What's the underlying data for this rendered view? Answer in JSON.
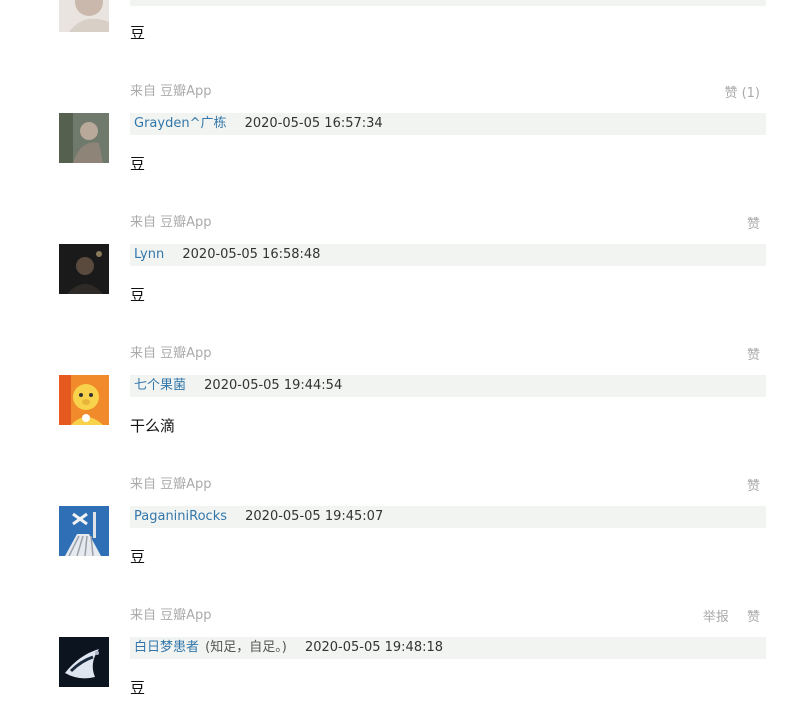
{
  "replies": [
    {
      "text": "豆"
    },
    {
      "source": "来自 豆瓣App",
      "like_label": "赞 (1)",
      "author": "Grayden^广栋",
      "time": "2020-05-05 16:57:34",
      "text": "豆"
    },
    {
      "source": "来自 豆瓣App",
      "like_label": "赞",
      "author": "Lynn",
      "time": "2020-05-05 16:58:48",
      "text": "豆"
    },
    {
      "source": "来自 豆瓣App",
      "like_label": "赞",
      "author": "七个果菌",
      "time": "2020-05-05 19:44:54",
      "text": "干么滴"
    },
    {
      "source": "来自 豆瓣App",
      "like_label": "赞",
      "author": "PaganiniRocks",
      "time": "2020-05-05 19:45:07",
      "text": "豆"
    },
    {
      "source": "来自 豆瓣App",
      "report_label": "举报",
      "like_label": "赞",
      "author": "白日梦患者",
      "signature": "(知足，自足。)",
      "time": "2020-05-05 19:48:18",
      "text": "豆"
    }
  ],
  "colors": {
    "author_link": "#3377aa",
    "meta_bg": "#f2f4f2",
    "muted": "#aaaaaa"
  }
}
